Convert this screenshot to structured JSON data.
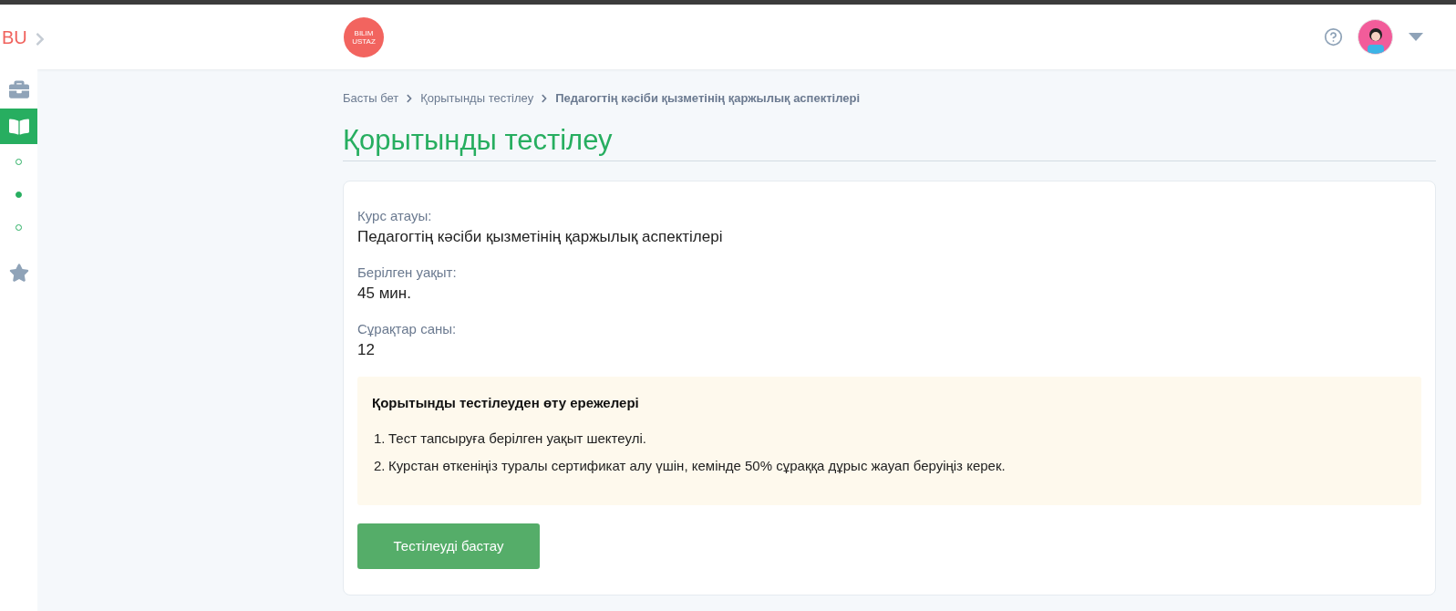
{
  "sidebar": {
    "brand": "BU",
    "items": [
      {
        "kind": "briefcase",
        "selected": false
      },
      {
        "kind": "book",
        "selected": true
      },
      {
        "kind": "dot",
        "selected": false
      },
      {
        "kind": "dot",
        "selected": true
      },
      {
        "kind": "dot",
        "selected": false
      },
      {
        "kind": "star",
        "selected": false
      }
    ]
  },
  "header": {
    "logo": [
      "BILIM",
      "USTAZ"
    ]
  },
  "breadcrumbs": [
    "Басты бет",
    "Қорытынды тестілеу",
    "Педагогтің кәсіби қызметінің қаржылық аспектілері"
  ],
  "title": "Қорытынды тестілеу",
  "fields": [
    {
      "label": "Курс атауы:",
      "value": "Педагогтің кәсіби қызметінің қаржылық аспектілері"
    },
    {
      "label": "Берілген уақыт:",
      "value": "45 мин."
    },
    {
      "label": "Сұрақтар саны:",
      "value": "12"
    }
  ],
  "rules": {
    "title": "Қорытынды тестілеуден өту ережелері",
    "items": [
      {
        "number": "1.",
        "text": "Тест тапсыруға берілген уақыт шектеулі."
      },
      {
        "number": "2.",
        "text": "Курстан өткеніңіз туралы сертификат алу үшін, кемінде 50% сұраққа дұрыс жауап беруіңіз керек."
      }
    ]
  },
  "start_button": "Тестілеуді бастау"
}
